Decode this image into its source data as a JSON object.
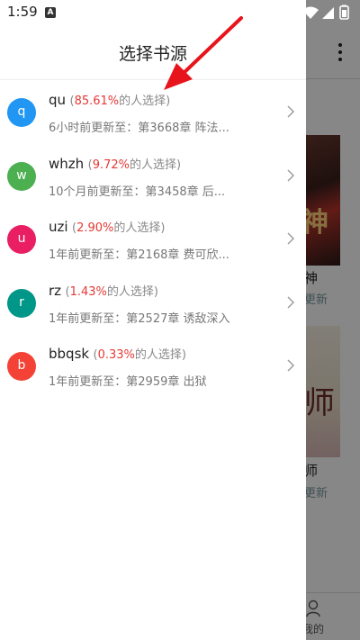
{
  "status_bar": {
    "time": "1:59",
    "notification_icon": "A"
  },
  "background_page": {
    "book1": {
      "cover_text": "神",
      "title": "神",
      "subtitle": "更新"
    },
    "book2": {
      "cover_text": "师",
      "title": "师",
      "subtitle": "更新"
    },
    "tab_label": "我的"
  },
  "drawer": {
    "title": "选择书源",
    "sources": [
      {
        "avatar": "q",
        "name": "qu",
        "percent": "85.61%",
        "suffix": "的人选择)",
        "prefix": "(",
        "update": "6小时前更新至：第3668章 阵法...",
        "color": "#2196f3"
      },
      {
        "avatar": "w",
        "name": "whzh",
        "percent": "9.72%",
        "suffix": "的人选择)",
        "prefix": "(",
        "update": "10个月前更新至：第3458章 后...",
        "color": "#4caf50"
      },
      {
        "avatar": "u",
        "name": "uzi",
        "percent": "2.90%",
        "suffix": "的人选择)",
        "prefix": "(",
        "update": "1年前更新至：第2168章 费可欣...",
        "color": "#e91e63"
      },
      {
        "avatar": "r",
        "name": "rz",
        "percent": "1.43%",
        "suffix": "的人选择)",
        "prefix": "(",
        "update": "1年前更新至：第2527章 诱敌深入",
        "color": "#009688"
      },
      {
        "avatar": "b",
        "name": "bbqsk",
        "percent": "0.33%",
        "suffix": "的人选择)",
        "prefix": "(",
        "update": "1年前更新至：第2959章 出狱",
        "color": "#f44336"
      }
    ]
  },
  "colors": {
    "accent_red": "#e53935",
    "annotation_arrow": "#e8141c"
  }
}
